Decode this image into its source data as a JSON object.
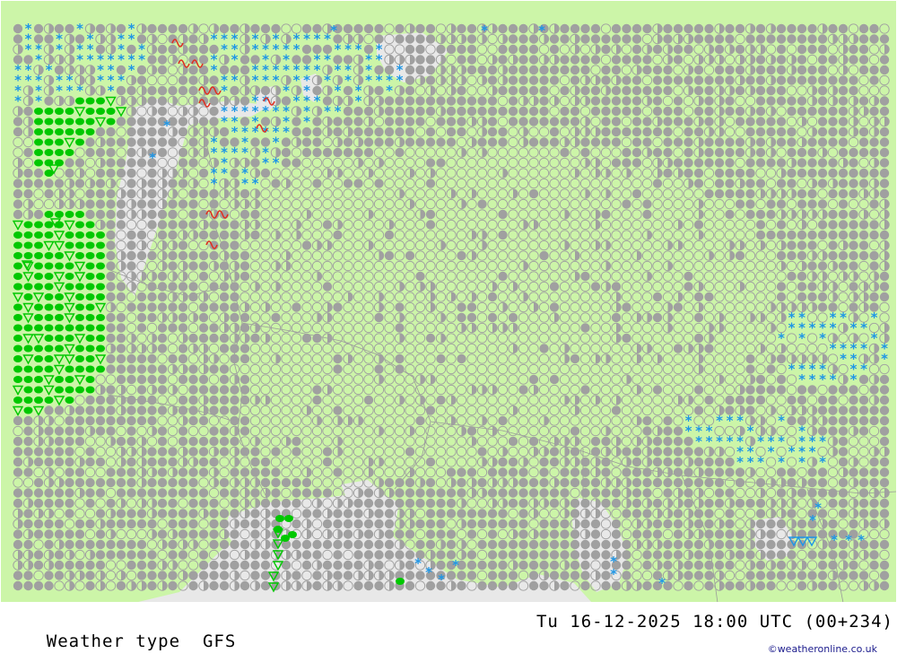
{
  "footer": {
    "product": "Weather type",
    "model": "GFS",
    "valid_time": "Tu 16-12-2025 18:00 UTC (00+234)",
    "credit": "©weatheronline.co.uk"
  },
  "legend_colors": {
    "land": "#ccf5a8",
    "bright_land": "#9be27a",
    "sea": "#e8e8e8",
    "cloud_symbol": "#a0a0a0",
    "rain_symbol": "#00c800",
    "snow_symbol": "#1e96e6",
    "thunder_symbol": "#e03020"
  },
  "symbols": {
    "overcast": "filled-grey-circle",
    "cloudy": "half-grey-circle",
    "clear": "open-circle",
    "rain": "green-dot",
    "rain_shower": "green-triangle",
    "snow": "blue-asterisk",
    "snow_shower": "blue-triangle",
    "freezing": "red-wave"
  }
}
